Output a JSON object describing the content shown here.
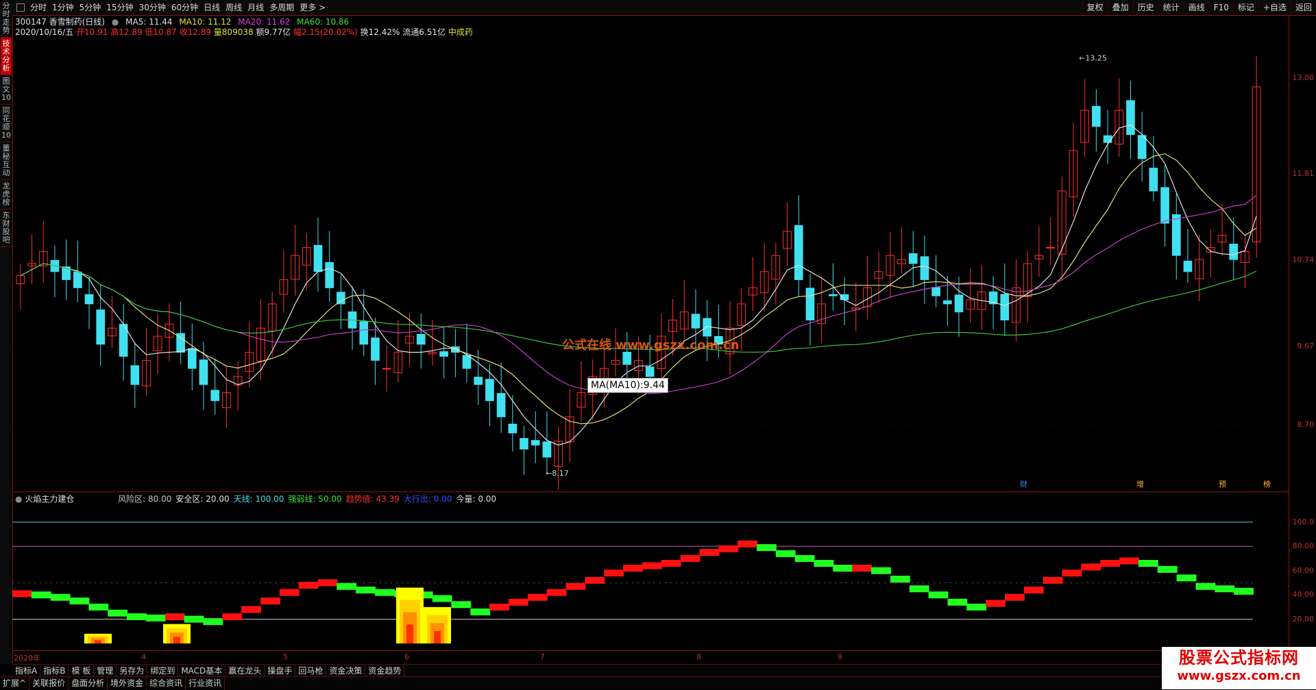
{
  "left_tabs": [
    "分时走势",
    "技术分析",
    "图文10",
    "同花顺10",
    "董秘互动",
    "龙虎榜",
    "东财股吧"
  ],
  "left_tab_active": 1,
  "top_menu": [
    "分时",
    "1分钟",
    "5分钟",
    "15分钟",
    "30分钟",
    "60分钟",
    "日线",
    "周线",
    "月线",
    "多周期",
    "更多 >"
  ],
  "top_right": [
    "复权",
    "叠加",
    "历史",
    "统计",
    "画线",
    "F10",
    "标记",
    "+自选",
    "返回"
  ],
  "info1": {
    "code_name": "300147 香雪制药(日线)",
    "ma5": "MA5: 11.44",
    "ma10": "MA10: 11.12",
    "ma20": "MA20: 11.62",
    "ma60": "MA60: 10.86"
  },
  "info2": {
    "date": "2020/10/16/五",
    "open": "开10.91",
    "high": "高12.89",
    "low": "低10.87",
    "close": "收12.89",
    "vol": "量809038",
    "amount": "额9.77亿",
    "change": "幅2.15(20.02%)",
    "turnover": "换12.42%",
    "float": "流通6.51亿",
    "sector": "中成药"
  },
  "price_axis": [
    "13.00",
    "11.81",
    "10.74",
    "9.67",
    "8.70"
  ],
  "annotations": {
    "high": "13.25",
    "low": "8.17"
  },
  "tooltip": "MA(MA10):9.44",
  "watermark": "公式在线 www.gszx.com.cn",
  "event_markers": [
    "财",
    "增",
    "预",
    "榜"
  ],
  "indicator": {
    "name": "火焰主力建仓",
    "params": [
      {
        "label": "风险区: 80.00",
        "color": "#c8c8c8"
      },
      {
        "label": "安全区: 20.00",
        "color": "#e0e0e0"
      },
      {
        "label": "天线: 100.00",
        "color": "#40e0e0"
      },
      {
        "label": "强弱线: 50.00",
        "color": "#40e040"
      },
      {
        "label": "趋势值: 43.39",
        "color": "#ff3030"
      },
      {
        "label": "大行出: 0.00",
        "color": "#3050ff"
      },
      {
        "label": "今量: 0.00",
        "color": "#e0e0e0"
      }
    ],
    "axis": [
      "100.0",
      "80.00",
      "60.00",
      "40.00",
      "20.00"
    ]
  },
  "months": [
    "2020年",
    "4",
    "5",
    "6",
    "7",
    "8",
    "9"
  ],
  "tools": [
    "指标A",
    "指标B",
    "模 板",
    "管理",
    "另存为",
    "绑定到",
    "MACD基本",
    "赢在龙头",
    "操盘手",
    "回马枪",
    "资金决策",
    "资金趋势"
  ],
  "bottom_tabs": [
    "扩展^",
    "关联报价",
    "盘面分析",
    "境外资金",
    "综合资讯",
    "行业资讯"
  ],
  "logo": {
    "title": "股票公式指标网",
    "url": "www.gszx.com.cn"
  },
  "colors": {
    "up": "#ff3030",
    "down": "#40e0f0",
    "ma5": "#e0e0e0",
    "ma10": "#e0e080",
    "ma20": "#c040c0",
    "ma60": "#40c040"
  },
  "chart_data": {
    "type": "candlestick",
    "close_series": [
      10.55,
      10.7,
      10.85,
      10.6,
      10.5,
      10.4,
      10.2,
      9.7,
      9.9,
      9.55,
      9.2,
      9.5,
      9.8,
      9.95,
      9.6,
      9.4,
      9.2,
      9.0,
      9.1,
      9.3,
      9.6,
      9.9,
      10.2,
      10.5,
      10.8,
      10.9,
      10.6,
      10.4,
      10.2,
      9.9,
      9.7,
      9.5,
      9.4,
      9.6,
      9.8,
      9.7,
      9.6,
      9.55,
      9.6,
      9.4,
      9.2,
      9.0,
      8.8,
      8.6,
      8.4,
      8.45,
      8.3,
      8.5,
      8.8,
      9.1,
      9.3,
      9.4,
      9.5,
      9.45,
      9.5,
      9.3,
      9.8,
      10.0,
      10.1,
      9.9,
      9.8,
      9.7,
      9.9,
      10.2,
      10.4,
      10.6,
      10.8,
      11.1,
      10.5,
      10.0,
      10.2,
      10.3,
      10.25,
      10.15,
      10.4,
      10.6,
      10.8,
      10.75,
      10.7,
      10.5,
      10.3,
      10.2,
      10.1,
      10.25,
      10.35,
      10.2,
      10.0,
      10.4,
      10.7,
      10.8,
      10.9,
      11.6,
      12.1,
      12.6,
      12.4,
      12.2,
      12.6,
      12.3,
      12.0,
      11.6,
      11.2,
      10.8,
      10.6,
      10.75,
      10.9,
      11.05,
      10.75,
      10.85,
      12.89
    ]
  }
}
